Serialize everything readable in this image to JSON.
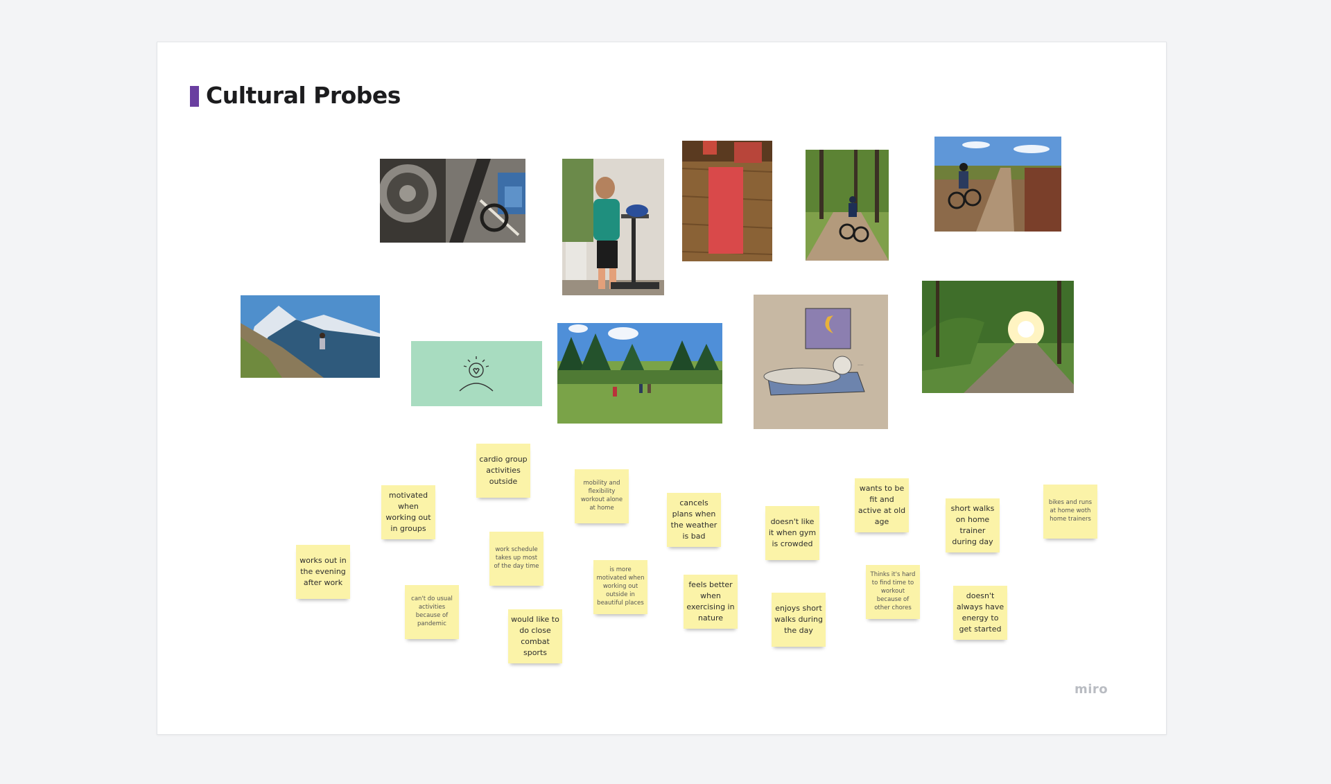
{
  "board": {
    "title": "Cultural Probes",
    "accent_color": "#6a3fa0",
    "logo_text": "miro"
  },
  "images": [
    {
      "name": "bike-gears-photo"
    },
    {
      "name": "woman-treadmill-photo"
    },
    {
      "name": "yoga-mat-photo"
    },
    {
      "name": "forest-cyclist-photo"
    },
    {
      "name": "field-cyclist-photo"
    },
    {
      "name": "mountain-hiker-photo"
    },
    {
      "name": "person-heart-icon-card",
      "icon": "person-heart-icon",
      "color": "#a8dcc0"
    },
    {
      "name": "meadow-hikers-photo"
    },
    {
      "name": "bed-drawing-photo"
    },
    {
      "name": "sunny-road-photo"
    }
  ],
  "stickies": [
    {
      "text": "cardio group activities outside"
    },
    {
      "text": "motivated when working out in groups"
    },
    {
      "text": "mobility and flexibility workout alone at home"
    },
    {
      "text": "cancels plans when the weather is bad"
    },
    {
      "text": "doesn't like it when gym is crowded"
    },
    {
      "text": "wants to be fit and active at old age"
    },
    {
      "text": "short walks on home trainer during day"
    },
    {
      "text": "bikes and runs at home woth home trainers"
    },
    {
      "text": "works out in the evening after work"
    },
    {
      "text": "work schedule takes up most of the day time"
    },
    {
      "text": "is more motivated when working out outside in beautiful places"
    },
    {
      "text": "feels better when exercising in nature"
    },
    {
      "text": "enjoys short walks during the day"
    },
    {
      "text": "Thinks it's hard to find time to workout because of other chores"
    },
    {
      "text": "doesn't always have energy to get started"
    },
    {
      "text": "can't do usual activities because of pandemic"
    },
    {
      "text": "would like to do close combat sports"
    }
  ]
}
